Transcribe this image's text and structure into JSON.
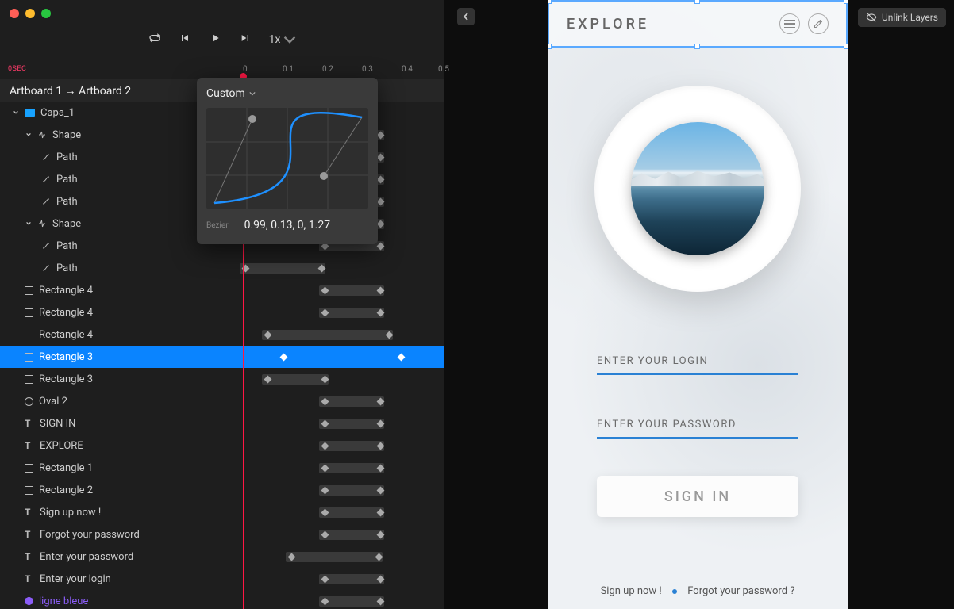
{
  "playback": {
    "speed": "1x"
  },
  "ruler": {
    "zero": "0SEC",
    "ticks": [
      "0",
      "0.1",
      "0.2",
      "0.3",
      "0.4",
      "0.5"
    ],
    "positions": [
      306,
      356,
      406,
      456,
      506,
      552
    ]
  },
  "transition": "Artboard 1 → Artboard 2",
  "easing": {
    "label": "Custom",
    "bezier_label": "Bezier",
    "values": "0.99, 0.13, 0, 1.27"
  },
  "layers": [
    {
      "name": "Capa_1",
      "icon": "folder",
      "indent": 0,
      "chev": true,
      "track": null
    },
    {
      "name": "Shape",
      "icon": "shape",
      "indent": 1,
      "chev": true,
      "track": {
        "l": 102,
        "w": 82,
        "kf": [
          4,
          74
        ]
      }
    },
    {
      "name": "Path",
      "icon": "path",
      "indent": 2,
      "track": {
        "l": 102,
        "w": 82,
        "kf": [
          4,
          74
        ]
      }
    },
    {
      "name": "Path",
      "icon": "path",
      "indent": 2,
      "track": {
        "l": 102,
        "w": 82,
        "kf": [
          4,
          74
        ]
      }
    },
    {
      "name": "Path",
      "icon": "path",
      "indent": 2,
      "track": {
        "l": 102,
        "w": 82,
        "kf": [
          4,
          74
        ]
      }
    },
    {
      "name": "Shape",
      "icon": "shape",
      "indent": 1,
      "chev": true,
      "track": {
        "l": 102,
        "w": 82,
        "kf": [
          4,
          74
        ]
      }
    },
    {
      "name": "Path",
      "icon": "path",
      "indent": 2,
      "track": {
        "l": 102,
        "w": 82,
        "kf": [
          4,
          74
        ]
      }
    },
    {
      "name": "Path",
      "icon": "path",
      "indent": 2,
      "track": {
        "l": 2,
        "w": 108,
        "kf": [
          4,
          100
        ]
      }
    },
    {
      "name": "Rectangle 4",
      "icon": "rect",
      "indent": 0,
      "track": {
        "l": 102,
        "w": 82,
        "kf": [
          4,
          74
        ]
      }
    },
    {
      "name": "Rectangle 4",
      "icon": "rect",
      "indent": 0,
      "track": {
        "l": 102,
        "w": 82,
        "kf": [
          4,
          74
        ]
      }
    },
    {
      "name": "Rectangle 4",
      "icon": "rect",
      "indent": 0,
      "track": {
        "l": 30,
        "w": 165,
        "kf": [
          4,
          157
        ]
      }
    },
    {
      "name": "Rectangle 3",
      "icon": "rect",
      "indent": 0,
      "sel": true,
      "track": {
        "l": 50,
        "w": 160,
        "kf": [
          4,
          152
        ],
        "sel": true
      }
    },
    {
      "name": "Rectangle 3",
      "icon": "rect",
      "indent": 0,
      "track": {
        "l": 30,
        "w": 84,
        "kf": [
          4,
          76
        ]
      }
    },
    {
      "name": "Oval 2",
      "icon": "circle",
      "indent": 0,
      "track": {
        "l": 102,
        "w": 82,
        "kf": [
          4,
          74
        ]
      }
    },
    {
      "name": "SIGN IN",
      "icon": "text",
      "indent": 0,
      "track": {
        "l": 102,
        "w": 82,
        "kf": [
          4,
          74
        ]
      }
    },
    {
      "name": "EXPLORE",
      "icon": "text",
      "indent": 0,
      "track": {
        "l": 102,
        "w": 82,
        "kf": [
          4,
          74
        ]
      }
    },
    {
      "name": "Rectangle 1",
      "icon": "rect",
      "indent": 0,
      "track": {
        "l": 102,
        "w": 82,
        "kf": [
          4,
          74
        ]
      }
    },
    {
      "name": "Rectangle 2",
      "icon": "rect",
      "indent": 0,
      "track": {
        "l": 102,
        "w": 82,
        "kf": [
          4,
          74
        ]
      }
    },
    {
      "name": "Sign up now !",
      "icon": "text",
      "indent": 0,
      "track": {
        "l": 102,
        "w": 82,
        "kf": [
          4,
          74
        ]
      }
    },
    {
      "name": "Forgot your password",
      "icon": "text",
      "indent": 0,
      "track": {
        "l": 102,
        "w": 82,
        "kf": [
          4,
          74
        ]
      }
    },
    {
      "name": "Enter your password",
      "icon": "text",
      "indent": 0,
      "track": {
        "l": 60,
        "w": 122,
        "kf": [
          4,
          114
        ]
      }
    },
    {
      "name": "Enter your login",
      "icon": "text",
      "indent": 0,
      "track": {
        "l": 102,
        "w": 82,
        "kf": [
          4,
          74
        ]
      }
    },
    {
      "name": "ligne bleue",
      "icon": "hex",
      "indent": 0,
      "blue": true,
      "track": {
        "l": 102,
        "w": 82,
        "kf": [
          4,
          74
        ]
      }
    }
  ],
  "unlink": "Unlink Layers",
  "mock": {
    "brand": "EXPLORE",
    "login_placeholder": "ENTER YOUR LOGIN",
    "password_placeholder": "ENTER YOUR PASSWORD",
    "signin": "SIGN IN",
    "signup": "Sign up now !",
    "forgot": "Forgot your password ?"
  }
}
